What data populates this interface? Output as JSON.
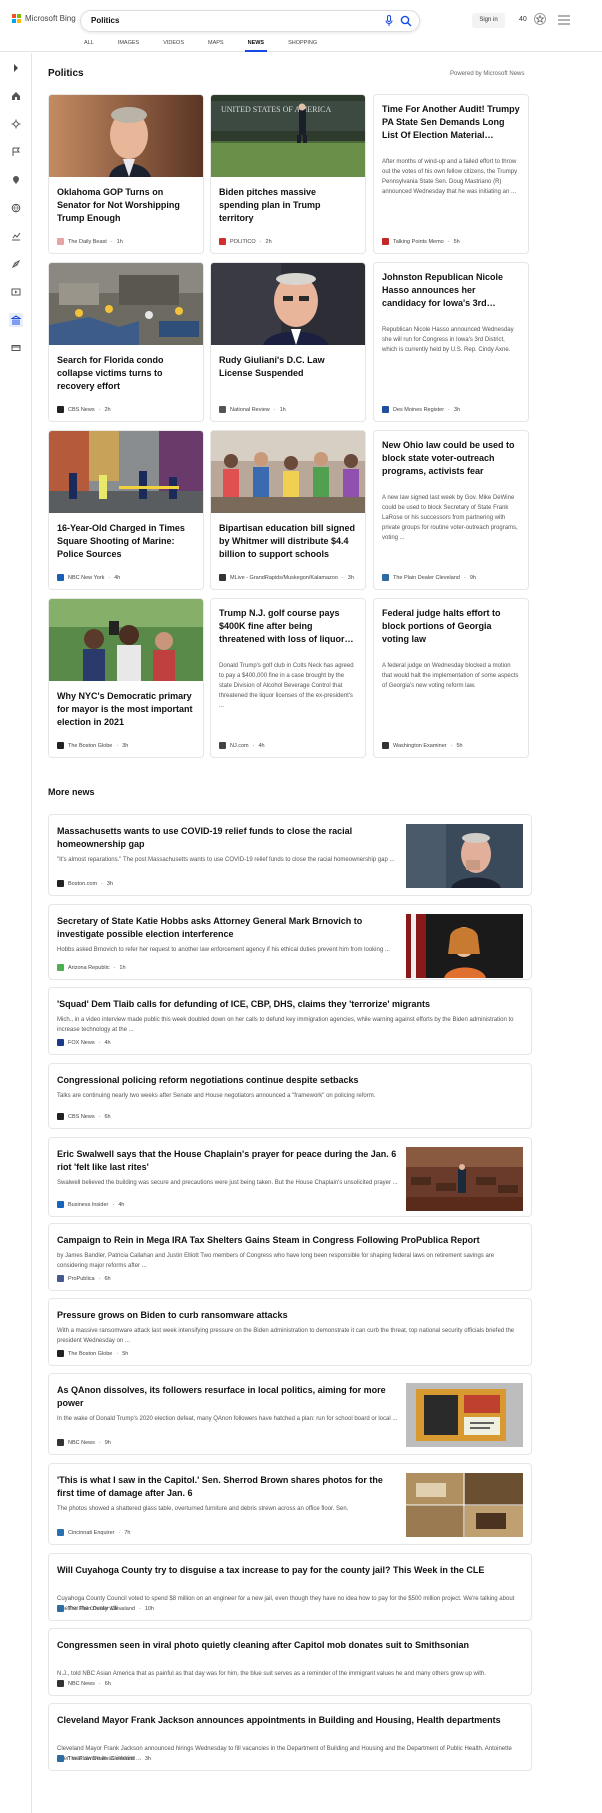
{
  "header": {
    "logo_text": "Microsoft Bing",
    "search_value": "Politics",
    "signin_label": "Sign in",
    "rewards_points": "40",
    "tabs": [
      "ALL",
      "IMAGES",
      "VIDEOS",
      "MAPS",
      "NEWS",
      "SHOPPING"
    ],
    "active_tab": "NEWS"
  },
  "section": {
    "title": "Politics",
    "powered_by": "Powered by Microsoft News"
  },
  "cards": [
    {
      "title": "Oklahoma GOP Turns on Senator for Not Worshipping Trump Enough",
      "source": "The Daily Beast",
      "time": "1h",
      "fav_color": "#e8a4a4"
    },
    {
      "title": "Biden pitches massive spending plan in Trump territory",
      "source": "POLITICO",
      "time": "2h",
      "fav_color": "#d32f2f"
    },
    {
      "title": "Time For Another Audit! Trumpy PA State Sen Demands Long List Of Election Material…",
      "desc": "After months of wind-up and a failed effort to throw out the votes of his own fellow citizens, the Trumpy Pennsylvania State Sen. Doug Mastriano (R) announced Wednesday that he was initiating an ...",
      "source": "Talking Points Memo",
      "time": "5h",
      "fav_color": "#c62828"
    },
    {
      "title": "Search for Florida condo collapse victims turns to recovery effort",
      "source": "CBS News",
      "time": "2h",
      "fav_color": "#222222"
    },
    {
      "title": "Rudy Giuliani's D.C. Law License Suspended",
      "source": "National Review",
      "time": "1h",
      "fav_color": "#555555"
    },
    {
      "title": "Johnston Republican Nicole Hasso announces her candidacy for Iowa's 3rd…",
      "desc": "Republican Nicole Hasso announced Wednesday she will run for Congress in Iowa's 3rd District, which is currently held by U.S. Rep. Cindy Axne.",
      "source": "Des Moines Register",
      "time": "3h",
      "fav_color": "#1e4fa0"
    },
    {
      "title": "16-Year-Old Charged in Times Square Shooting of Marine: Police Sources",
      "source": "NBC New York",
      "time": "4h",
      "fav_color": "#1a5fb4"
    },
    {
      "title": "Bipartisan education bill signed by Whitmer will distribute $4.4 billion to support schools",
      "source": "MLive - GrandRapids/Muskegon/Kalamazoo",
      "time": "3h",
      "fav_color": "#333333"
    },
    {
      "title": "New Ohio law could be used to block state voter-outreach programs, activists fear",
      "desc": "A new law signed last week by Gov. Mike DeWine could be used to block Secretary of State Frank LaRose or his successors from partnering with private groups for routine voter-outreach programs, voting ...",
      "source": "The Plain Dealer Cleveland",
      "time": "9h",
      "fav_color": "#2e6da4"
    },
    {
      "title": "Why NYC's Democratic primary for mayor is the most important election in 2021",
      "source": "The Boston Globe",
      "time": "3h",
      "fav_color": "#222222"
    },
    {
      "title": "Trump N.J. golf course pays $400K fine after being threatened with loss of liquor…",
      "desc": "Donald Trump's golf club in Colts Neck has agreed to pay a $400,000 fine in a case brought by the state Division of Alcohol Beverage Control that threatened the liquor licenses of the ex-president's ...",
      "source": "NJ.com",
      "time": "4h",
      "fav_color": "#444444"
    },
    {
      "title": "Federal judge halts effort to block portions of Georgia voting law",
      "desc": "A federal judge on Wednesday blocked a motion that would halt the implementation of some aspects of Georgia's new voting reform law.",
      "source": "Washington Examiner",
      "time": "5h",
      "fav_color": "#333333"
    }
  ],
  "more_news": {
    "title": "More news",
    "items": [
      {
        "title": "Massachusetts wants to use COVID-19 relief funds to close the racial homeownership gap",
        "desc": "\"It's almost reparations.\" The post Massachusetts wants to use COVID-19 relief funds to close the racial homeownership gap ...",
        "source": "Boston.com",
        "time": "3h",
        "fav_color": "#222222"
      },
      {
        "title": "Secretary of State Katie Hobbs asks Attorney General Mark Brnovich to investigate possible election interference",
        "desc": "Hobbs asked Brnovich to refer her request to another law enforcement agency if his ethical duties prevent him from looking ...",
        "source": "Arizona Republic",
        "time": "1h",
        "fav_color": "#4caf50"
      },
      {
        "title": "'Squad' Dem Tlaib calls for defunding of ICE, CBP, DHS, claims they 'terrorize' migrants",
        "desc": "Mich., in a video interview made public this week doubled down on her calls to defund key immigration agencies, while warning against efforts by the Biden administration to increase technology at the ...",
        "source": "FOX News",
        "time": "4h",
        "fav_color": "#1b3a8a"
      },
      {
        "title": "Congressional policing reform negotiations continue despite setbacks",
        "desc": "Talks are continuing nearly two weeks after Senate and House negotiators announced a \"framework\" on policing reform.",
        "source": "CBS News",
        "time": "6h",
        "fav_color": "#222222"
      },
      {
        "title": "Eric Swalwell says that the House Chaplain's prayer for peace during the Jan. 6 riot 'felt like last rites'",
        "desc": "Swalwell believed the building was secure and precautions were just being taken. But the House Chaplain's unsolicited prayer ...",
        "source": "Business Insider",
        "time": "4h",
        "fav_color": "#1565c0"
      },
      {
        "title": "Campaign to Rein in Mega IRA Tax Shelters Gains Steam in Congress Following ProPublica Report",
        "desc": "by James Bandler, Patricia Callahan and Justin Elliott Two members of Congress who have long been responsible for shaping federal laws on retirement savings are considering major reforms after ...",
        "source": "ProPublica",
        "time": "6h",
        "fav_color": "#455a90"
      },
      {
        "title": "Pressure grows on Biden to curb ransomware attacks",
        "desc": "With a massive ransomware attack last week intensifying pressure on the Biden administration to demonstrate it can curb the threat, top national security officials briefed the president Wednesday on ...",
        "source": "The Boston Globe",
        "time": "5h",
        "fav_color": "#222222"
      },
      {
        "title": "As QAnon dissolves, its followers resurface in local politics, aiming for more power",
        "desc": "In the wake of Donald Trump's 2020 election defeat, many QAnon followers have hatched a plan: run for school board or local ...",
        "source": "NBC News",
        "time": "9h",
        "fav_color": "#333333"
      },
      {
        "title": "'This is what I saw in the Capitol.' Sen. Sherrod Brown shares photos for the first time of damage after Jan. 6",
        "desc": "The photos showed a shattered glass table, overturned furniture and debris strewn across an office floor.  Sen.",
        "source": "Cincinnati Enquirer",
        "time": "7h",
        "fav_color": "#2a6fb0"
      },
      {
        "title": "Will Cuyahoga County try to disguise a tax increase to pay for the county jail? This Week in the CLE",
        "desc": "Cuyahoga County Council voted to spend $8 million on an engineer for a new jail, even though they have no idea how to pay for the $500 million project. We're talking about whether the county will ...",
        "source": "The Plain Dealer Cleveland",
        "time": "10h",
        "fav_color": "#2e6da4"
      },
      {
        "title": "Congressmen seen in viral photo quietly cleaning after Capitol mob donates suit to Smithsonian",
        "desc": "N.J., told NBC Asian America that as painful as that day was for him, the blue suit serves as a reminder of the immigrant values he and many others grew up with.",
        "source": "NBC News",
        "time": "6h",
        "fav_color": "#333333"
      },
      {
        "title": "Cleveland Mayor Frank Jackson announces appointments in Building and Housing, Health departments",
        "desc": "Cleveland Mayor Frank Jackson announced hirings Wednesday to fill vacancies in the Department of Building and Housing and the Department of Public Health. Antoinette Allen was sworn in as interim ...",
        "source": "The Plain Dealer Cleveland",
        "time": "3h",
        "fav_color": "#2e6da4"
      }
    ]
  }
}
